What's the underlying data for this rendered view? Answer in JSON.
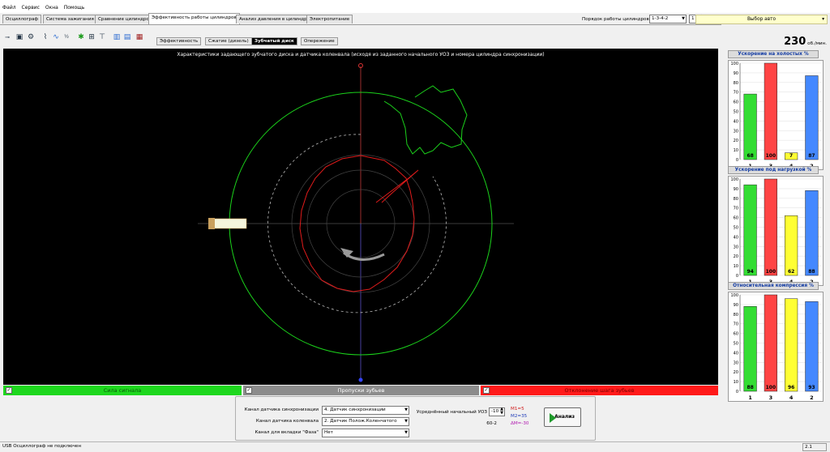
{
  "menu": [
    "Файл",
    "Сервис",
    "Окна",
    "Помощь"
  ],
  "tabs": [
    {
      "label": "Осциллограф",
      "active": false
    },
    {
      "label": "Система зажигания",
      "active": false
    },
    {
      "label": "Сравнение цилиндров",
      "active": false
    },
    {
      "label": "Эффективность работы цилиндров",
      "active": true
    },
    {
      "label": "Анализ давления в цилиндре",
      "active": false
    },
    {
      "label": "Электропитание",
      "active": false
    }
  ],
  "config": {
    "firing_order_label": "Порядок работы цилиндров",
    "firing_order_value": "1-3-4-2",
    "cylinder_value": "1",
    "auto_select_label": "Выбор авто"
  },
  "toolbar_icons": [
    "plug-icon",
    "car-battery-icon",
    "cog-car-icon",
    "waveform-icon",
    "graph-icon",
    "ratio-icon",
    "gear-icon",
    "ruler-icon",
    "filter-icon",
    "chart-icon",
    "counter-icon",
    "engine-icon"
  ],
  "subtabs": [
    {
      "label": "Эффективность",
      "active": false
    },
    {
      "label": "Сжатие (дизель)",
      "active": false
    },
    {
      "label": "Зубчатый диск",
      "active": true
    },
    {
      "label": "Опережение",
      "active": false
    }
  ],
  "rpm": {
    "value": "230",
    "unit": "об./мин."
  },
  "plot": {
    "title": "Характеристики задающего зубчатого диска и датчика коленвала (исходя из заданного начального УОЗ и номера цилиндра синхронизации)"
  },
  "side_charts": [
    {
      "title": "Ускорение на холостых %",
      "categories": [
        "1",
        "3",
        "4",
        "2"
      ],
      "values": [
        68,
        100,
        7,
        87
      ],
      "colors": [
        "#33dd33",
        "#ff4444",
        "#ffff33",
        "#4488ff"
      ],
      "ylim": [
        0,
        100
      ]
    },
    {
      "title": "Ускорение под нагрузкой %",
      "categories": [
        "1",
        "3",
        "4",
        "2"
      ],
      "values": [
        94,
        100,
        62,
        88
      ],
      "colors": [
        "#33dd33",
        "#ff4444",
        "#ffff33",
        "#4488ff"
      ],
      "ylim": [
        0,
        100
      ]
    },
    {
      "title": "Относительная компрессия %",
      "categories": [
        "1",
        "3",
        "4",
        "2"
      ],
      "values": [
        88,
        100,
        96,
        93
      ],
      "colors": [
        "#33dd33",
        "#ff4444",
        "#ffff33",
        "#4488ff"
      ],
      "ylim": [
        0,
        100
      ]
    }
  ],
  "status_bars": [
    {
      "label": "Сила сигнала",
      "color": "#1ed71e",
      "text_color": "#0a5a0a",
      "checked": "✓"
    },
    {
      "label": "Пропуски зубьев",
      "color": "#8c8c8c",
      "text_color": "#ffffff",
      "checked": "✓"
    },
    {
      "label": "Отклонение шага зубьев",
      "color": "#ff1a1a",
      "text_color": "#7a0000",
      "checked": "✓"
    }
  ],
  "controls": {
    "sync_channel_label": "Канал датчика синхронизации",
    "sync_channel_value": "4. Датчик синхронизации",
    "crank_channel_label": "Канал датчика коленвала",
    "crank_channel_value": "2. Датчик Полож.Коленчатого Вал",
    "phase_channel_label": "Канал для вкладки \"Фаза\"",
    "phase_channel_value": "Нет",
    "avg_advance_label": "Усреднённый начальный УОЗ",
    "avg_advance_value": "-10",
    "teeth_pattern": "60-2",
    "m1": "M1=5",
    "m2": "M2=35",
    "dm": "ΔM=-30",
    "analyze_label": "Анализ"
  },
  "statusbar": {
    "text": "USB Осциллограф не подключен",
    "version": "2.1"
  }
}
